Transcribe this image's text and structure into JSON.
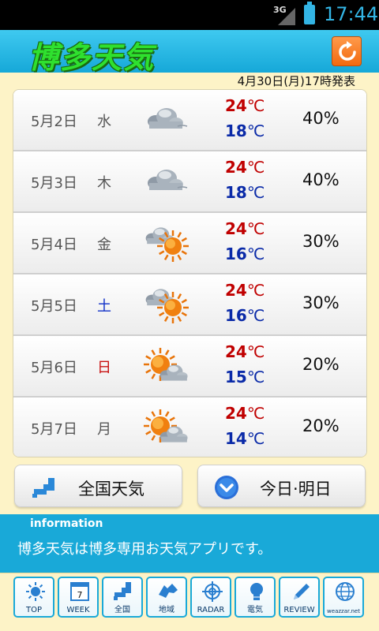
{
  "status_bar": {
    "network": "3G",
    "time": "17:44"
  },
  "header": {
    "title": "博多天気"
  },
  "published": "4月30日(月)17時発表",
  "forecast": [
    {
      "date": "5月2日",
      "dow": "水",
      "weather": "cloudy",
      "high": "24",
      "low": "18",
      "pop": "40%"
    },
    {
      "date": "5月3日",
      "dow": "木",
      "weather": "cloudy",
      "high": "24",
      "low": "18",
      "pop": "40%"
    },
    {
      "date": "5月4日",
      "dow": "金",
      "weather": "cloudy-then-sunny",
      "high": "24",
      "low": "16",
      "pop": "30%"
    },
    {
      "date": "5月5日",
      "dow": "土",
      "weather": "cloudy-then-sunny",
      "high": "24",
      "low": "16",
      "pop": "30%"
    },
    {
      "date": "5月6日",
      "dow": "日",
      "weather": "sunny-then-cloudy",
      "high": "24",
      "low": "15",
      "pop": "20%"
    },
    {
      "date": "5月7日",
      "dow": "月",
      "weather": "sunny-then-cloudy",
      "high": "24",
      "low": "14",
      "pop": "20%"
    }
  ],
  "temp_unit": "℃",
  "buttons": {
    "nationwide": "全国天気",
    "today_tomorrow": "今日·明日"
  },
  "info": {
    "title": "information",
    "message": "博多天気は博多専用お天気アプリです。"
  },
  "nav": [
    {
      "label": "TOP",
      "icon": "sun-icon"
    },
    {
      "label": "WEEK",
      "icon": "calendar-icon",
      "badge": "7"
    },
    {
      "label": "全国",
      "icon": "japan-map-icon"
    },
    {
      "label": "地域",
      "icon": "hokkaido-map-icon"
    },
    {
      "label": "RADAR",
      "icon": "crosshair-icon"
    },
    {
      "label": "電気",
      "icon": "light-bulb-icon"
    },
    {
      "label": "REVIEW",
      "icon": "pencil-icon"
    },
    {
      "label": "weazzar.net",
      "icon": "globe-icon"
    }
  ],
  "colors": {
    "accent": "#19a9d8",
    "background": "#fdf3c7",
    "high_temp": "#c00000",
    "low_temp": "#0a2aa8",
    "title": "#2fe02f"
  }
}
